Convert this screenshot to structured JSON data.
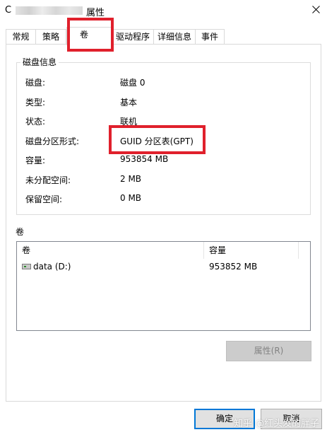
{
  "window": {
    "title_prefix": "C",
    "title": "属性",
    "close_icon": "close-icon"
  },
  "tabs": [
    {
      "label": "常规"
    },
    {
      "label": "策略"
    },
    {
      "label": "卷",
      "selected": true
    },
    {
      "label": "驱动程序"
    },
    {
      "label": "详细信息"
    },
    {
      "label": "事件"
    }
  ],
  "disk_info": {
    "group_title": "磁盘信息",
    "rows": [
      {
        "label": "磁盘:",
        "value": "磁盘 0"
      },
      {
        "label": "类型:",
        "value": "基本"
      },
      {
        "label": "状态:",
        "value": "联机"
      },
      {
        "label": "磁盘分区形式:",
        "value": "GUID 分区表(GPT)"
      },
      {
        "label": "容量:",
        "value": "953854 MB"
      },
      {
        "label": "未分配空间:",
        "value": "2 MB"
      },
      {
        "label": "保留空间:",
        "value": "0 MB"
      }
    ]
  },
  "volumes": {
    "heading": "卷",
    "columns": [
      "卷",
      "容量"
    ],
    "rows": [
      {
        "name": "data (D:)",
        "capacity": "953852 MB"
      }
    ],
    "properties_button": "属性(R)"
  },
  "footer": {
    "ok_button": "确定",
    "cancel_button": "取消"
  },
  "watermark": "知乎 @红头发的胖子",
  "colors": {
    "highlight": "#e0202c",
    "focus_border": "#0078d7"
  }
}
